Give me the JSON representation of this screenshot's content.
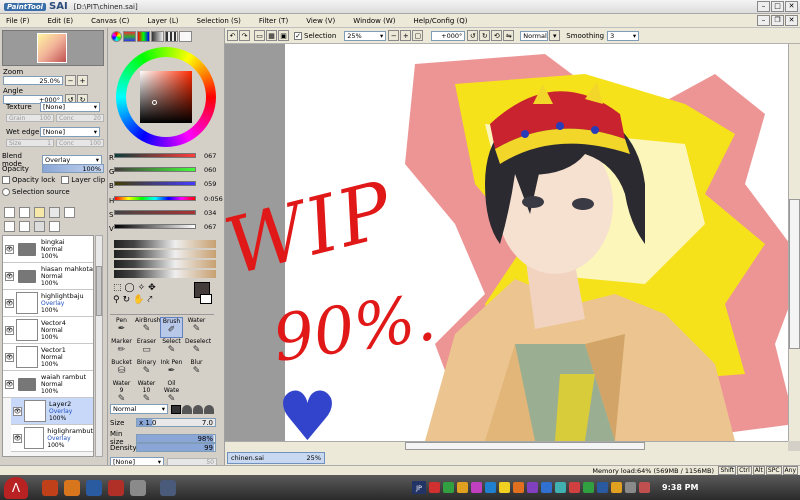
{
  "window": {
    "logo": "PaintTool",
    "logo2": "SAI",
    "title": "[D:\\PIT\\chinen.sai]"
  },
  "menu": [
    "File (F)",
    "Edit (E)",
    "Canvas (C)",
    "Layer (L)",
    "Selection (S)",
    "Filter (T)",
    "View (V)",
    "Window (W)",
    "Help/Config (Q)"
  ],
  "navigator": {
    "zoom_label": "Zoom",
    "zoom_value": "25.0%",
    "angle_label": "Angle",
    "angle_value": "+000°"
  },
  "brush_options": {
    "texture_label": "Texture",
    "texture_value": "[None]",
    "grain_label": "Grain",
    "grain_value": "100",
    "conc1_label": "Conc",
    "conc1_value": "20",
    "wet_edge_label": "Wet edge",
    "wet_edge_value": "[None]",
    "size_label": "Size",
    "size_value": "1",
    "conc2_label": "Conc",
    "conc2_value": "100",
    "blend_mode_label": "Blend mode",
    "blend_mode_value": "Overlay",
    "opacity_label": "Opacity",
    "opacity_value": "100%",
    "opacity_lock": "Opacity lock",
    "layer_clip": "Layer clip",
    "selection_source": "Selection source"
  },
  "layers": [
    {
      "name": "bingkai",
      "mode": "Normal",
      "opacity": "100%",
      "type": "folder"
    },
    {
      "name": "hiasan mahkota",
      "mode": "Normal",
      "opacity": "100%",
      "type": "folder"
    },
    {
      "name": "highlightbaju",
      "mode": "Overlay",
      "opacity": "100%",
      "type": "layer"
    },
    {
      "name": "Vector4",
      "mode": "Normal",
      "opacity": "100%",
      "type": "layer"
    },
    {
      "name": "Vector1",
      "mode": "Normal",
      "opacity": "100%",
      "type": "layer"
    },
    {
      "name": "waiah rambut",
      "mode": "Normal",
      "opacity": "100%",
      "type": "folder"
    },
    {
      "name": "Layer2",
      "mode": "Overlay",
      "opacity": "100%",
      "type": "layer",
      "selected": true
    },
    {
      "name": "higlighrambut",
      "mode": "Overlay",
      "opacity": "100%",
      "type": "layer"
    }
  ],
  "color_sliders": [
    {
      "label": "R",
      "value": "067"
    },
    {
      "label": "G",
      "value": "060"
    },
    {
      "label": "B",
      "value": "059"
    },
    {
      "label": "H",
      "value": "0:056"
    },
    {
      "label": "S",
      "value": "034"
    },
    {
      "label": "V",
      "value": "067"
    }
  ],
  "tools": [
    {
      "name": "Pen",
      "icon": "pen-icon"
    },
    {
      "name": "AirBrush",
      "icon": "airbrush-icon"
    },
    {
      "name": "Brush",
      "icon": "brush-icon",
      "selected": true
    },
    {
      "name": "Water",
      "icon": "water-icon"
    },
    {
      "name": "Marker",
      "icon": "marker-icon"
    },
    {
      "name": "Eraser",
      "icon": "eraser-icon"
    },
    {
      "name": "Select",
      "icon": "select-icon"
    },
    {
      "name": "Deselect",
      "icon": "deselect-icon"
    },
    {
      "name": "Bucket",
      "icon": "bucket-icon"
    },
    {
      "name": "Binary",
      "icon": "binary-icon"
    },
    {
      "name": "Ink Pen",
      "icon": "inkpen-icon"
    },
    {
      "name": "Blur",
      "icon": "blur-icon"
    },
    {
      "name": "Water",
      "sub": "9",
      "icon": "water-icon"
    },
    {
      "name": "Water",
      "sub": "10",
      "icon": "water-icon"
    },
    {
      "name": "Oil Wate",
      "icon": "oil-water-icon"
    }
  ],
  "tool_options": {
    "blend": "Normal",
    "size_label": "Size",
    "size_mult": "x 1.0",
    "size_value": "7.0",
    "min_size_label": "Min size",
    "min_size_value": "98%",
    "density_label": "Density",
    "density_value": "99",
    "texture_value": "[None]",
    "texture_num": "50"
  },
  "canvas_toolbar": {
    "selection_label": "Selection",
    "zoom": "25%",
    "angle": "+000°",
    "mode": "Normal",
    "smoothing_label": "Smoothing",
    "smoothing_value": "3"
  },
  "canvas_text": {
    "line1": "WIP",
    "line2": "90%."
  },
  "doc_tab": {
    "name": "chinen.sai",
    "zoom": "25%"
  },
  "status": {
    "memory": "Memory load:64% (569MB / 1156MB)",
    "keys": [
      "Shift",
      "Ctrl",
      "Alt",
      "SPC",
      "Any"
    ]
  },
  "taskbar": {
    "lang": "JP",
    "time": "9:38 PM"
  },
  "colors": {
    "brand": "#3a6ea8",
    "selected": "#c8d8f8",
    "wip_red": "#e01818",
    "heart_blue": "#3344cc"
  }
}
